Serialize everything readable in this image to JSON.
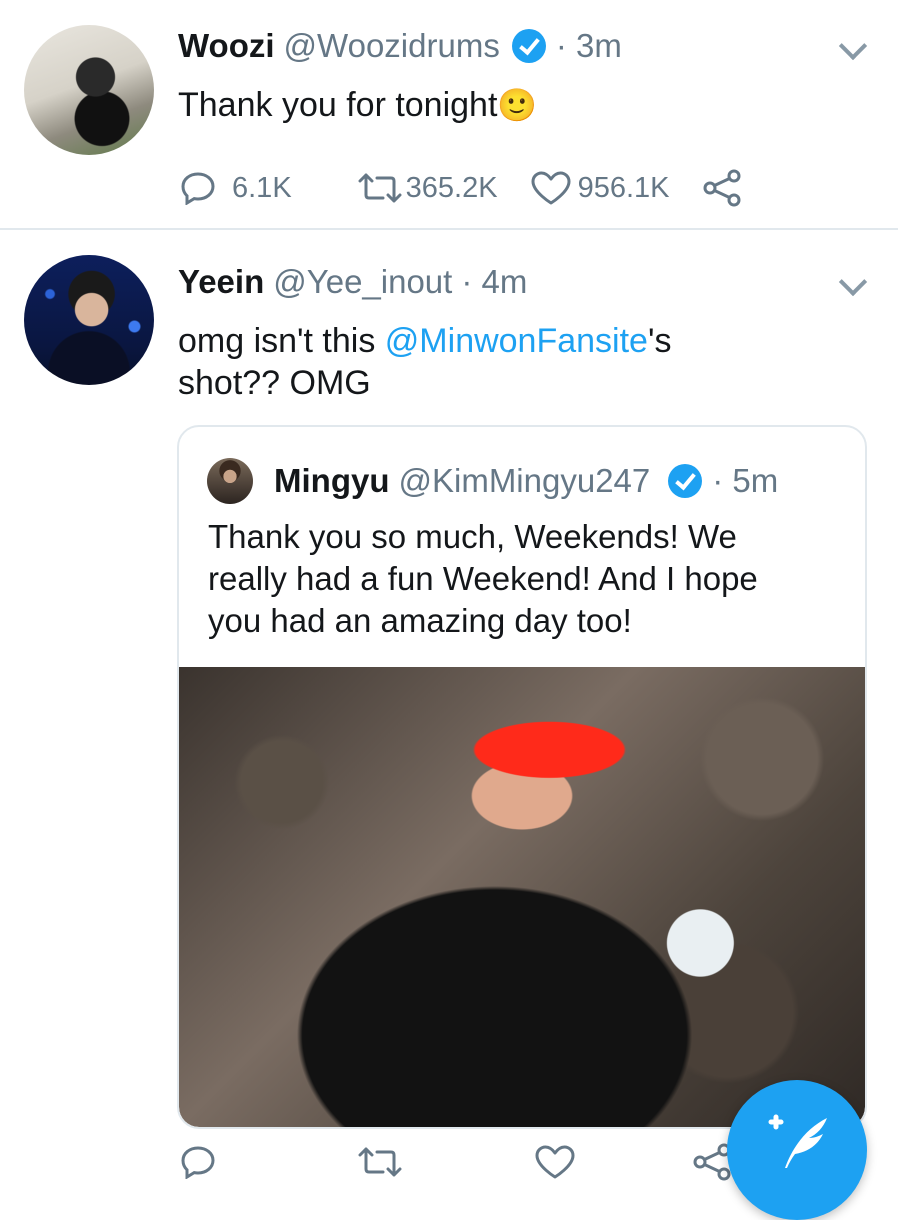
{
  "tweets": [
    {
      "display_name": "Woozi",
      "handle": "@Woozidrums",
      "time": "· 3m",
      "text": "Thank you for tonight",
      "emoji": "🙂",
      "replies": "6.1K",
      "retweets": "365.2K",
      "likes": "956.1K"
    },
    {
      "display_name": "Yeein",
      "handle": "@Yee_inout",
      "time": "· 4m",
      "text_before": "omg isn't this ",
      "mention": "@MinwonFansite",
      "text_after": "'s shot?? OMG"
    }
  ],
  "quoted": {
    "display_name": "Mingyu",
    "handle": "@KimMingyu247",
    "time": "· 5m",
    "text": "Thank you so much, Weekends! We really had a fun Weekend! And I hope you had an amazing day too!"
  },
  "colors": {
    "accent": "#1da1f2",
    "secondary_text": "#657786",
    "divider": "#e1e8ed"
  },
  "icons": [
    "reply-icon",
    "retweet-icon",
    "like-icon",
    "share-icon",
    "chevron-down-icon",
    "verified-badge-icon",
    "compose-tweet-icon"
  ]
}
